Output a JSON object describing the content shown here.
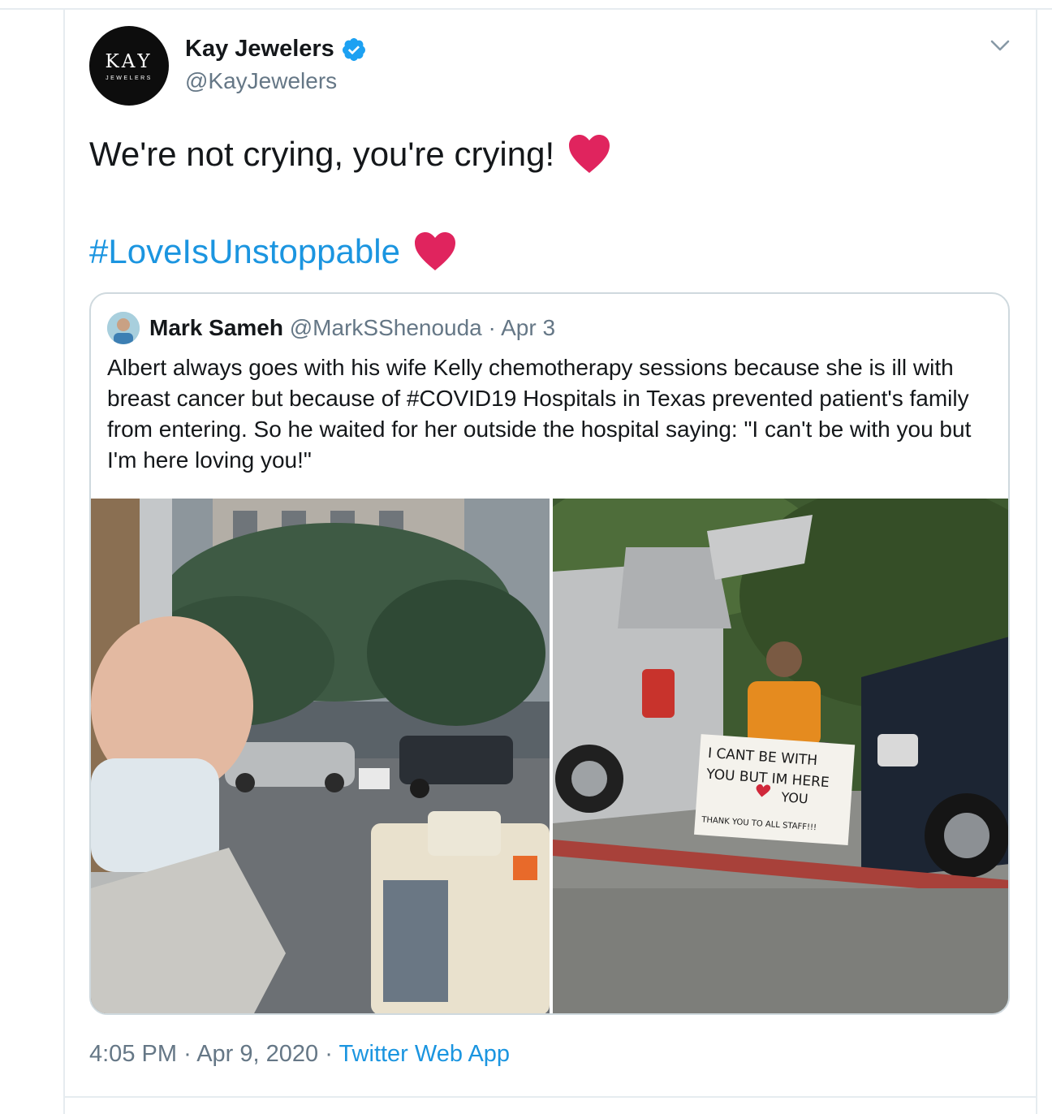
{
  "tweet": {
    "display_name": "Kay Jewelers",
    "handle": "@KayJewelers",
    "avatar_text": "KAY",
    "avatar_subtext": "JEWELERS",
    "text": "We're not crying, you're crying!",
    "hashtag": "#LoveIsUnstoppable",
    "time": "4:05 PM",
    "date": "Apr 9, 2020",
    "separator": "·",
    "source": "Twitter Web App"
  },
  "quoted": {
    "display_name": "Mark Sameh",
    "handle": "@MarkSShenouda",
    "separator": "·",
    "date": "Apr 3",
    "text": "Albert always goes with his wife Kelly chemotherapy sessions because she is ill with breast cancer but because of #COVID19 Hospitals in Texas prevented patient's family from entering. So he waited for her outside the hospital saying: \"I can't be with you but I'm here loving you!\"",
    "sign": {
      "line1": "I CANT BE WITH",
      "line2": "YOU BUT IM HERE",
      "line3": "YOU",
      "line4": "THANK YOU TO ALL STAFF!!!"
    }
  },
  "colors": {
    "link": "#1b95e0",
    "heart": "#e0245e",
    "verified": "#1da1f2",
    "secondary_text": "#657786"
  },
  "icons": [
    "verified-badge-icon",
    "chevron-down-icon",
    "heart-icon"
  ]
}
